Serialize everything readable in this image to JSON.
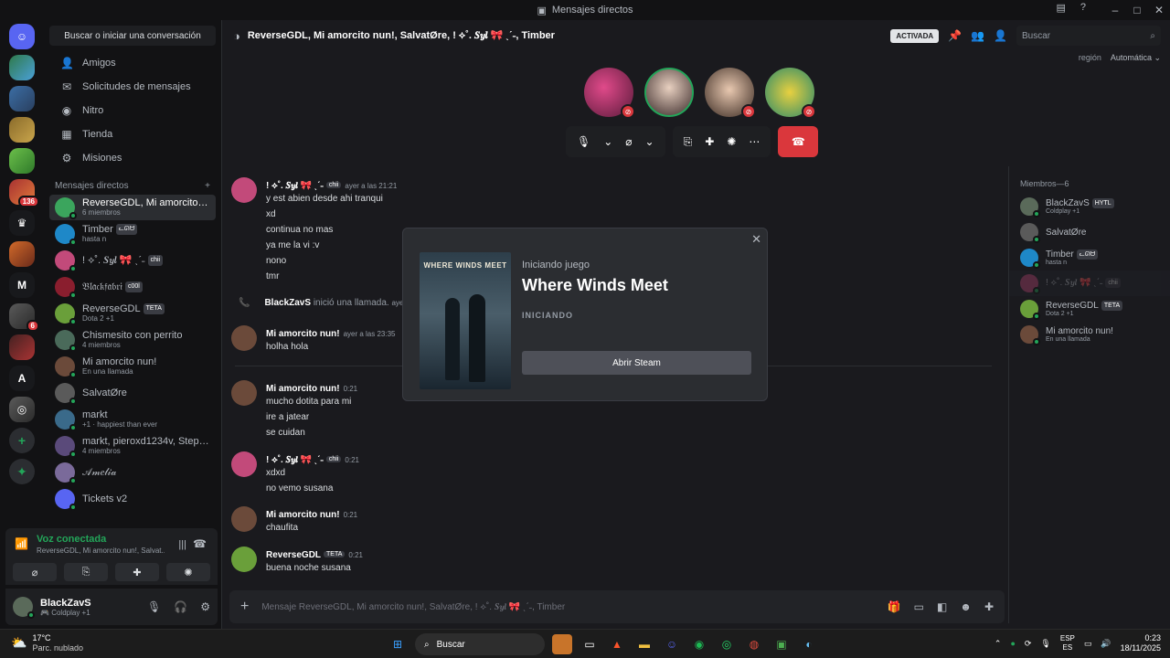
{
  "window": {
    "title": "Mensajes directos"
  },
  "dm_sidebar": {
    "search_label": "Buscar o iniciar una conversación",
    "nav": [
      {
        "label": "Amigos",
        "icon": "friends-icon"
      },
      {
        "label": "Solicitudes de mensajes",
        "icon": "mail-icon"
      },
      {
        "label": "Nitro",
        "icon": "nitro-icon"
      },
      {
        "label": "Tienda",
        "icon": "shop-icon"
      },
      {
        "label": "Misiones",
        "icon": "quest-icon"
      }
    ],
    "section_title": "Mensajes directos",
    "add_label": "+",
    "dms": [
      {
        "name": "ReverseGDL, Mi amorcito nun!, Salvat...",
        "sub": "6 miembros",
        "color": "#3ba55d"
      },
      {
        "name": "Timber",
        "tag": "ᓚᘏᗢ",
        "sub": "hasta n",
        "color": "#1e88c8"
      },
      {
        "name": "! ⟡˚. 𝑺𝒚𝒍 🎀 ˎˊ˗",
        "tag": "chii",
        "sub": "",
        "color": "#c24a7a"
      },
      {
        "name": "𝔅𝔩𝔞𝔠𝔨𝔣𝔞𝔟𝔯𝔦",
        "tag": "c00l",
        "sub": "",
        "color": "#8a1e2e"
      },
      {
        "name": "ReverseGDL",
        "tag": "TETA",
        "sub": "Dota 2 +1",
        "color": "#6a9f3a"
      },
      {
        "name": "Chismesito con perrito",
        "sub": "4 miembros",
        "color": "#4a6a5a"
      },
      {
        "name": "Mi amorcito nun!",
        "sub": "En una llamada",
        "color": "#6b4a3a"
      },
      {
        "name": "SalvatØre",
        "sub": "",
        "color": "#5a5a5a"
      },
      {
        "name": "markt",
        "sub": "+1 · happiest than ever",
        "color": "#3a6a8a"
      },
      {
        "name": "markt, pieroxd1234v, Steph...",
        "sub": "4 miembros",
        "color": "#5a4a7a"
      },
      {
        "name": "𝒜𝓂𝑒𝓁𝒾𝒶",
        "sub": "",
        "color": "#7a6a9a"
      },
      {
        "name": "Tickets v2",
        "sub": "",
        "color": "#5865f2"
      }
    ]
  },
  "voice": {
    "status": "Voz conectada",
    "channel": "ReverseGDL, Mi amorcito nun!, Salvat..."
  },
  "user": {
    "name": "BlackZavS",
    "status": "Coldplay +1"
  },
  "header": {
    "title": "ReverseGDL, Mi amorcito nun!, SalvatØre, ! ⟡˚. 𝑺𝒚𝒍 🎀 ˎˊ˗, Timber",
    "activated": "ACTIVADA",
    "search_placeholder": "Buscar",
    "region_label": "región",
    "region_value": "Automática"
  },
  "messages": [
    {
      "author": "! ⟡˚. 𝑺𝒚𝒍 🎀 ˎˊ˗",
      "tag": "chii",
      "time": "ayer a las 21:21",
      "lines": [
        "y est abien desde ahi tranqui",
        "xd",
        "continua no mas",
        "ya me la vi :v",
        "nono",
        "tmr"
      ],
      "color": "#c24a7a"
    },
    {
      "system": true,
      "author": "BlackZavS",
      "text": "inició una llamada.",
      "time": "ayer"
    },
    {
      "author": "Mi amorcito nun!",
      "time": "ayer a las 23:35",
      "lines": [
        "holha hola"
      ],
      "color": "#6b4a3a"
    },
    {
      "author": "Mi amorcito nun!",
      "time": "0:21",
      "lines": [
        "mucho dotita para mi",
        "ire a jatear",
        "se cuidan"
      ],
      "color": "#6b4a3a"
    },
    {
      "author": "! ⟡˚. 𝑺𝒚𝒍 🎀 ˎˊ˗",
      "tag": "chii",
      "time": "0:21",
      "lines": [
        "xdxd",
        "no vemo susana"
      ],
      "color": "#c24a7a"
    },
    {
      "author": "Mi amorcito nun!",
      "time": "0:21",
      "lines": [
        "chaufita"
      ],
      "color": "#6b4a3a"
    },
    {
      "author": "ReverseGDL",
      "tag": "TETA",
      "time": "0:21",
      "lines": [
        "buena noche susana"
      ],
      "color": "#6a9f3a"
    }
  ],
  "composer": {
    "placeholder": "Mensaje ReverseGDL, Mi amorcito nun!, SalvatØre, ! ⟡˚. 𝑺𝒚𝒍 🎀 ˎˊ˗, Timber"
  },
  "members": {
    "title": "Miembros—6",
    "list": [
      {
        "name": "BlackZavS",
        "tag": "HYTL",
        "sub": "Coldplay +1",
        "color": "#5a6a5a"
      },
      {
        "name": "SalvatØre",
        "sub": "",
        "color": "#5a5a5a"
      },
      {
        "name": "Timber",
        "tag": "ᓚᘏᗢ",
        "sub": "hasta n",
        "color": "#1e88c8"
      },
      {
        "name": "! ⟡˚. 𝑺𝒚𝒍 🎀 ˎˊ˗",
        "tag": "chii",
        "sub": "",
        "color": "#c24a7a",
        "dim": true
      },
      {
        "name": "ReverseGDL",
        "tag": "TETA",
        "sub": "Dota 2 +1",
        "color": "#6a9f3a"
      },
      {
        "name": "Mi amorcito nun!",
        "sub": "En una llamada",
        "color": "#6b4a3a"
      }
    ]
  },
  "modal": {
    "label": "Iniciando juego",
    "game": "Where Winds Meet",
    "state": "INICIANDO",
    "button": "Abrir Steam",
    "cover_text": "WHERE WINDS MEET"
  },
  "taskbar": {
    "temp": "17°C",
    "weather": "Parc. nublado",
    "search": "Buscar",
    "lang1": "ESP",
    "lang2": "ES",
    "time": "0:23",
    "date": "18/11/2025"
  },
  "server_badges": {
    "b1": "136",
    "b2": "6"
  }
}
